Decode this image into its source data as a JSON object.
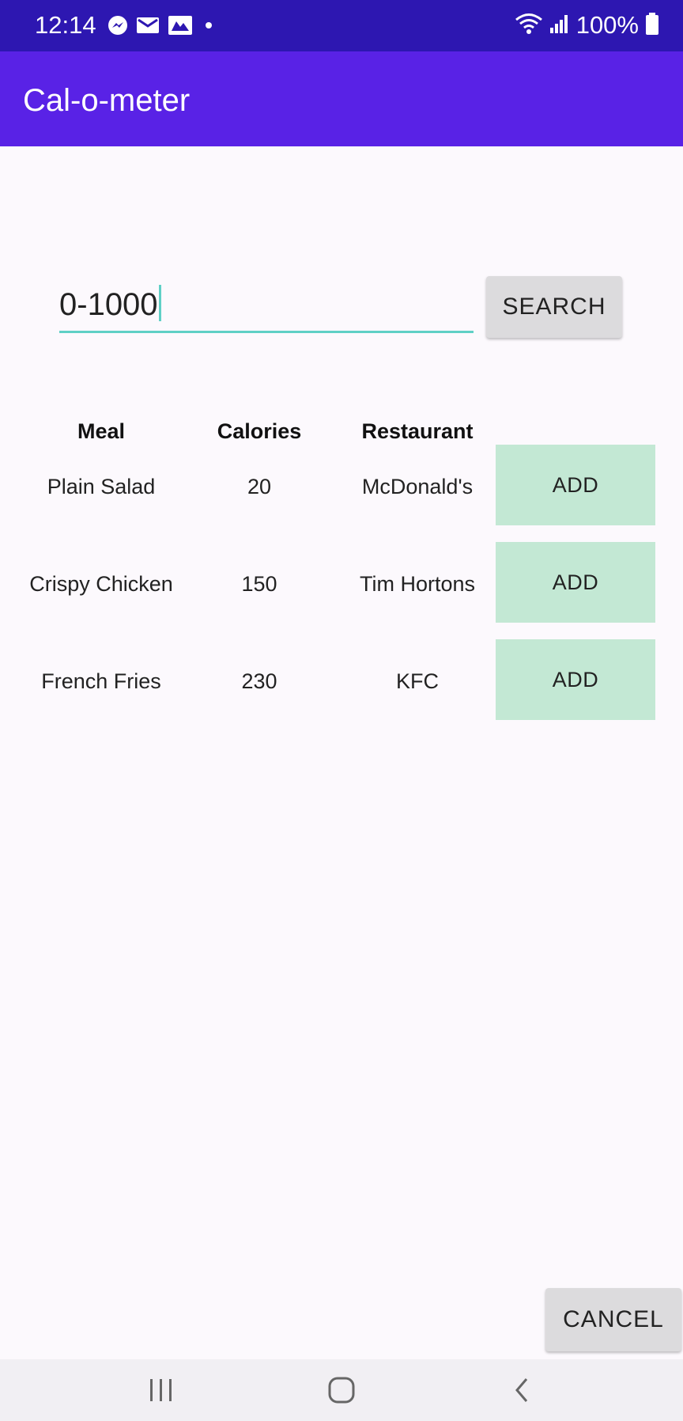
{
  "status_bar": {
    "time": "12:14",
    "battery": "100%",
    "notification_icons": [
      "messenger-icon",
      "email-icon",
      "gallery-icon",
      "dot-icon"
    ],
    "right_icons": [
      "wifi-icon",
      "signal-icon",
      "battery-icon"
    ]
  },
  "app_bar": {
    "title": "Cal-o-meter"
  },
  "search": {
    "value": "0-1000",
    "button_label": "SEARCH"
  },
  "table": {
    "headers": [
      "Meal",
      "Calories",
      "Restaurant"
    ],
    "rows": [
      {
        "meal": "Plain Salad",
        "calories": "20",
        "restaurant": "McDonald's",
        "action": "ADD"
      },
      {
        "meal": "Crispy Chicken",
        "calories": "150",
        "restaurant": "Tim Hortons",
        "action": "ADD"
      },
      {
        "meal": "French Fries",
        "calories": "230",
        "restaurant": "KFC",
        "action": "ADD"
      }
    ]
  },
  "footer": {
    "cancel_label": "CANCEL"
  },
  "nav_bar": {
    "items": [
      "recent-apps-icon",
      "home-icon",
      "back-icon"
    ]
  },
  "colors": {
    "status_bar": "#2d17b1",
    "app_bar": "#5922e6",
    "accent": "#5fd0c6",
    "add_button": "#c3e8d4",
    "button_gray": "#dcdbdd"
  }
}
